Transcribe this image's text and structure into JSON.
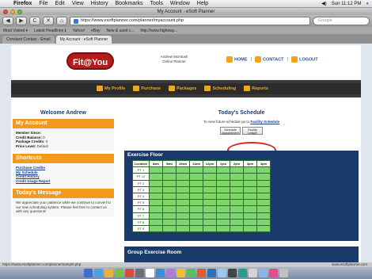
{
  "menubar": {
    "app": "Firefox",
    "menus": [
      "File",
      "Edit",
      "View",
      "History",
      "Bookmarks",
      "Tools",
      "Window",
      "Help"
    ],
    "clock": "Sun 11:12 PM"
  },
  "window": {
    "title": "My Account - eSoft Planner"
  },
  "toolbar": {
    "back": "◀",
    "forward": "▶",
    "reload": "C",
    "stop": "✕",
    "home": "⌂",
    "url": "https://www.esoftplanner.com/planner/myaccount.php",
    "search_placeholder": "Google"
  },
  "bookmarks": [
    "Most Visited ▾",
    "Latest Headlines ℹ",
    "Yahoo!",
    "eBay",
    "New & used c...",
    "http://www.highway..."
  ],
  "tabs": [
    "Constant Contact - Email",
    "My Account - eSoft Planner"
  ],
  "header": {
    "logo_text": "Fit@You",
    "user_name": "Andrew McIntosh",
    "user_role": "Online Planner",
    "links": [
      "HOME",
      "CONTACT",
      "LOGOUT"
    ]
  },
  "nav": [
    "My Profile",
    "Purchase",
    "Packages",
    "Scheduling",
    "Reports"
  ],
  "sidebar": {
    "welcome": "Welcome Andrew",
    "account_head": "My Account",
    "account_lines": [
      {
        "label": "Member Since:",
        "value": ""
      },
      {
        "label": "Credit Balance:",
        "value": "0"
      },
      {
        "label": "Package Credits:",
        "value": "0"
      },
      {
        "label": "Price Level:",
        "value": "Default"
      }
    ],
    "shortcuts_head": "Shortcuts",
    "shortcuts": [
      "Purchase Credits",
      "My Schedule",
      "Credit History",
      "Credit Usage Report"
    ],
    "message_head": "Today's Message",
    "message": "We appreciate your patience while we continue to convert to our new scheduling system. Please feel free to contact us with any questions!"
  },
  "main": {
    "title": "Today's Schedule",
    "note_prefix": "To view future schedule go to",
    "note_link": "Facility Schedule",
    "buttons": [
      "Schedule Appointment",
      "Facility Ledger"
    ],
    "exercise_floor": "Exercise Floor",
    "columns": [
      "Location",
      "8am",
      "9am",
      "10am",
      "11am",
      "12pm",
      "1pm",
      "2pm",
      "3pm",
      "4pm"
    ],
    "locations": [
      "PT 1",
      "PT 12",
      "PT 2",
      "PT 3",
      "PT 4",
      "PT 5",
      "PT 6",
      "PT 7",
      "PT 8",
      "PT 9"
    ],
    "group_room": "Group Exercise Room"
  },
  "statusbar": {
    "left": "https://www.esoftplanner.com/planner/sample.php",
    "right": "www.esoftplanner.com"
  },
  "colors": {
    "accent": "#f39a1d",
    "panel": "#1a3a6c",
    "slot": "#7ed66d",
    "highlight": "#e0231b"
  }
}
